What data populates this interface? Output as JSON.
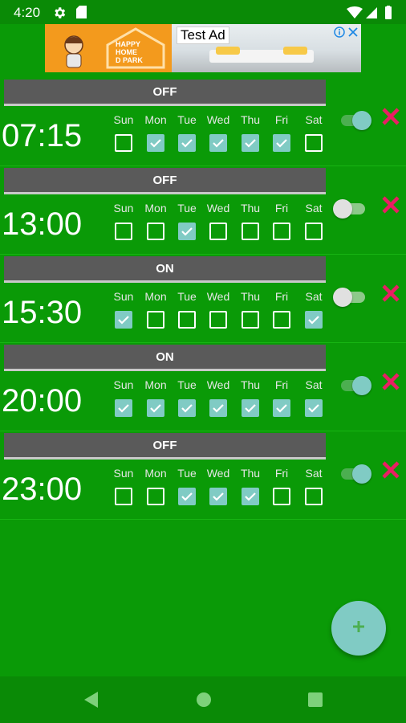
{
  "status_bar": {
    "time": "4:20",
    "icons": [
      "gear-icon",
      "sd-card-icon",
      "wifi-icon",
      "signal-icon",
      "battery-icon"
    ]
  },
  "ad": {
    "label": "Test Ad",
    "brand_lines": [
      "HAPPY",
      "HOME",
      "D PARK"
    ]
  },
  "days": [
    "Sun",
    "Mon",
    "Tue",
    "Wed",
    "Thu",
    "Fri",
    "Sat"
  ],
  "alarms": [
    {
      "status": "OFF",
      "time": "07:15",
      "enabled": true,
      "days": [
        false,
        true,
        true,
        true,
        true,
        true,
        false
      ]
    },
    {
      "status": "OFF",
      "time": "13:00",
      "enabled": false,
      "days": [
        false,
        false,
        true,
        false,
        false,
        false,
        false
      ]
    },
    {
      "status": "ON",
      "time": "15:30",
      "enabled": false,
      "days": [
        true,
        false,
        false,
        false,
        false,
        false,
        true
      ]
    },
    {
      "status": "ON",
      "time": "20:00",
      "enabled": true,
      "days": [
        true,
        true,
        true,
        true,
        true,
        true,
        true
      ]
    },
    {
      "status": "OFF",
      "time": "23:00",
      "enabled": true,
      "days": [
        false,
        false,
        true,
        true,
        true,
        false,
        false
      ]
    }
  ],
  "colors": {
    "background": "#0a9a07",
    "accent": "#80cbc4",
    "delete": "#e91e63",
    "status_bar": "#5a5a5a"
  },
  "fab_icon": "plus-icon",
  "nav": [
    "back-icon",
    "home-icon",
    "recents-icon"
  ]
}
